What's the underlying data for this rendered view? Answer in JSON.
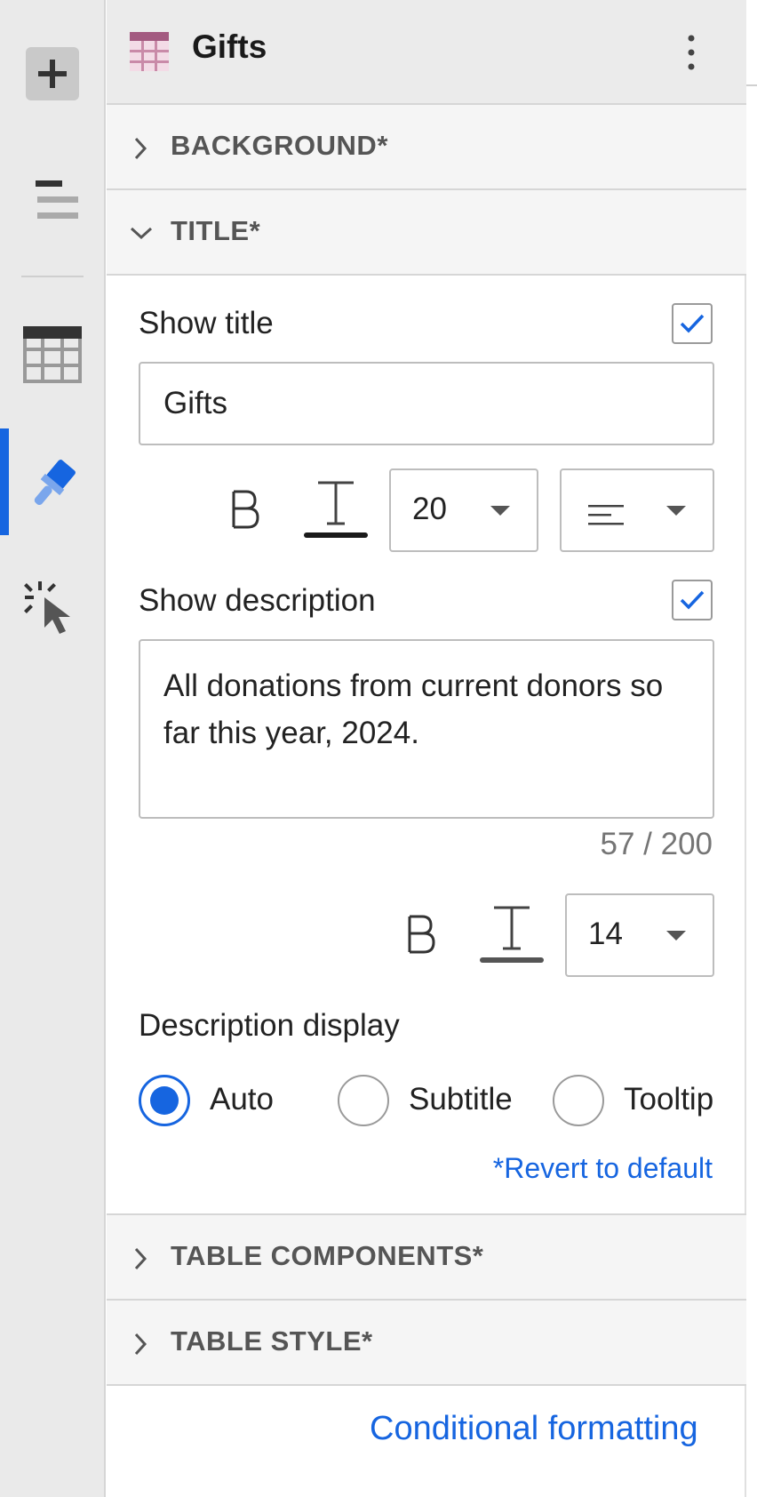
{
  "panel_header": {
    "title": "Gifts"
  },
  "sections": {
    "background": "BACKGROUND*",
    "title": "TITLE*",
    "table_components": "TABLE COMPONENTS*",
    "table_style": "TABLE STYLE*"
  },
  "title_section": {
    "show_title_label": "Show title",
    "show_title_checked": true,
    "title_value": "Gifts",
    "title_font_size": "20",
    "show_description_label": "Show description",
    "show_description_checked": true,
    "description_value": "All donations from current donors so far this year, 2024.",
    "description_counter": "57 / 200",
    "description_font_size": "14",
    "description_display_label": "Description display",
    "display_options": [
      {
        "label": "Auto",
        "selected": true
      },
      {
        "label": "Subtitle",
        "selected": false
      },
      {
        "label": "Tooltip",
        "selected": false
      }
    ],
    "revert_label": "*Revert to default"
  },
  "footer": {
    "conditional_formatting_label": "Conditional formatting"
  },
  "colors": {
    "accent": "#1665e0",
    "rail": "#eaeaea",
    "section_bg": "#f5f5f5"
  }
}
